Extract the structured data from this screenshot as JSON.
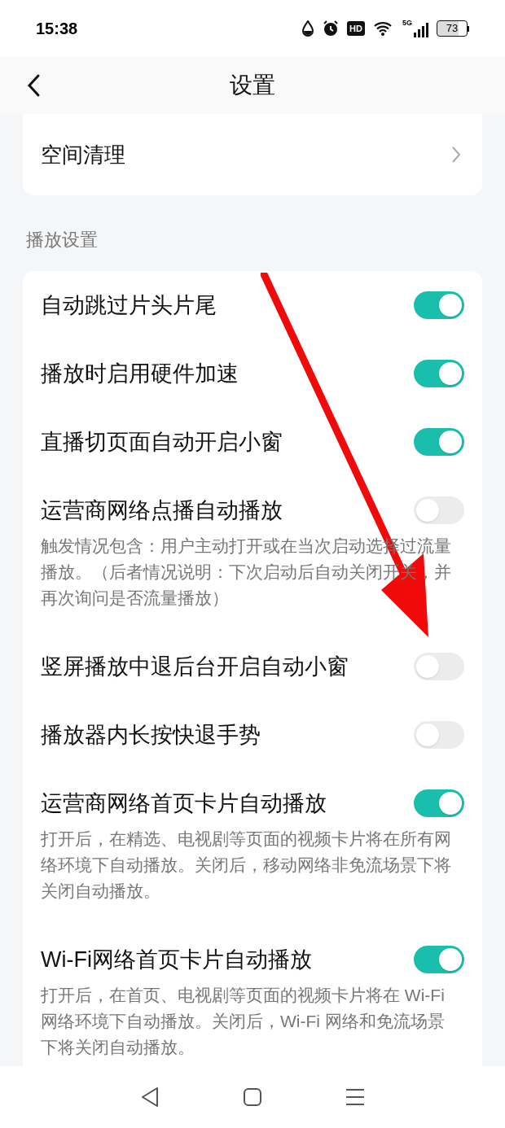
{
  "status_bar": {
    "time": "15:38",
    "hd_label": "HD",
    "network": "5G",
    "battery": "73"
  },
  "header": {
    "title": "设置"
  },
  "storage_card": {
    "items": [
      {
        "label": "空间清理"
      }
    ]
  },
  "section_title": "播放设置",
  "settings": [
    {
      "label": "自动跳过片头片尾",
      "on": true
    },
    {
      "label": "播放时启用硬件加速",
      "on": true
    },
    {
      "label": "直播切页面自动开启小窗",
      "on": true
    },
    {
      "label": "运营商网络点播自动播放",
      "on": false,
      "description": "触发情况包含：用户主动打开或在当次启动选择过流量播放。（后者情况说明：下次启动后自动关闭开关，并再次询问是否流量播放）"
    },
    {
      "label": "竖屏播放中退后台开启自动小窗",
      "on": false
    },
    {
      "label": "播放器内长按快退手势",
      "on": false
    },
    {
      "label": "运营商网络首页卡片自动播放",
      "on": true,
      "description": "打开后，在精选、电视剧等页面的视频卡片将在所有网络环境下自动播放。关闭后，移动网络非免流场景下将关闭自动播放。"
    },
    {
      "label": "Wi-Fi网络首页卡片自动播放",
      "on": true,
      "description": "打开后，在首页、电视剧等页面的视频卡片将在 Wi-Fi 网络环境下自动播放。关闭后，Wi-Fi 网络和免流场景下将关闭自动播放。"
    }
  ]
}
